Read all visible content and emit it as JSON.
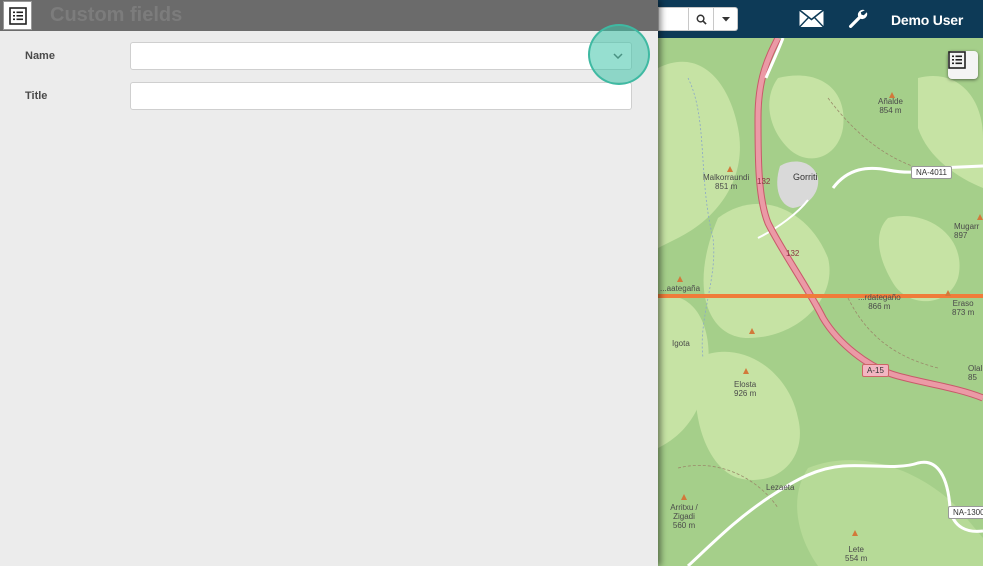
{
  "panel": {
    "title": "Custom fields",
    "fields": [
      {
        "label": "Name",
        "value": "",
        "placeholder": ""
      },
      {
        "label": "Title",
        "value": "",
        "placeholder": ""
      }
    ]
  },
  "topbar": {
    "search_value": "",
    "user_name": "Demo User"
  },
  "map": {
    "places": [
      {
        "name": "Añalde",
        "elev": "854 m"
      },
      {
        "name": "Malkorraundi",
        "elev": "851 m"
      },
      {
        "name": "Gorriti",
        "elev": ""
      },
      {
        "name": "Mugarr",
        "elev": "897"
      },
      {
        "name": "...aategaña",
        "elev": ""
      },
      {
        "name": "...rdategaño",
        "elev": "866 m"
      },
      {
        "name": "Eraso",
        "elev": "873 m"
      },
      {
        "name": "Igota",
        "elev": ""
      },
      {
        "name": "Olal",
        "elev": "85"
      },
      {
        "name": "Elosta",
        "elev": "926 m"
      },
      {
        "name": "Lezaeta",
        "elev": ""
      },
      {
        "name": "Arritxu / Zigadi",
        "elev": "560 m"
      },
      {
        "name": "Lete",
        "elev": "554 m"
      }
    ],
    "roads": [
      "NA-4011",
      "132",
      "132",
      "A-15",
      "NA-1300"
    ]
  },
  "colors": {
    "topbar_bg": "#0d3a57",
    "panel_header_bg": "#6b6b6b",
    "highlight": "#3fb9a2",
    "map_green": "#a5cf8a",
    "highway": "#e8929f",
    "boundary": "#f07c3a"
  },
  "icons": {
    "panel_toggle": "list-icon",
    "search": "search-icon",
    "dropdown": "chevron-down-icon",
    "mail": "mail-icon",
    "settings": "wrench-icon",
    "layers": "list-icon"
  }
}
